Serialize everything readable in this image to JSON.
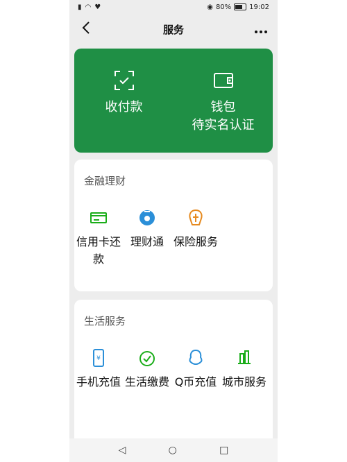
{
  "status_bar": {
    "battery": "80%",
    "time": "19:02"
  },
  "nav": {
    "title": "服务",
    "back_icon": "back-chevron-icon",
    "more_icon": "more-dots-icon"
  },
  "wallet_card": {
    "color": "#1f8f45",
    "items": [
      {
        "label": "收付款",
        "icon": "scan-receive-icon"
      },
      {
        "label": "钱包",
        "sub": "待实名认证",
        "icon": "wallet-icon"
      }
    ]
  },
  "finance": {
    "title": "金融理财",
    "items": [
      {
        "label": "信用卡还款",
        "icon": "credit-card-icon"
      },
      {
        "label": "理财通",
        "icon": "wealth-icon"
      },
      {
        "label": "保险服务",
        "icon": "insurance-icon"
      }
    ]
  },
  "life": {
    "title": "生活服务",
    "items": [
      {
        "label": "手机充值",
        "icon": "phone-recharge-icon"
      },
      {
        "label": "生活缴费",
        "icon": "utility-payment-icon"
      },
      {
        "label": "Q币充值",
        "icon": "qcoin-icon"
      },
      {
        "label": "城市服务",
        "icon": "city-service-icon"
      }
    ]
  },
  "system_nav": {
    "back": "◁",
    "home": "○",
    "recent": "□"
  }
}
